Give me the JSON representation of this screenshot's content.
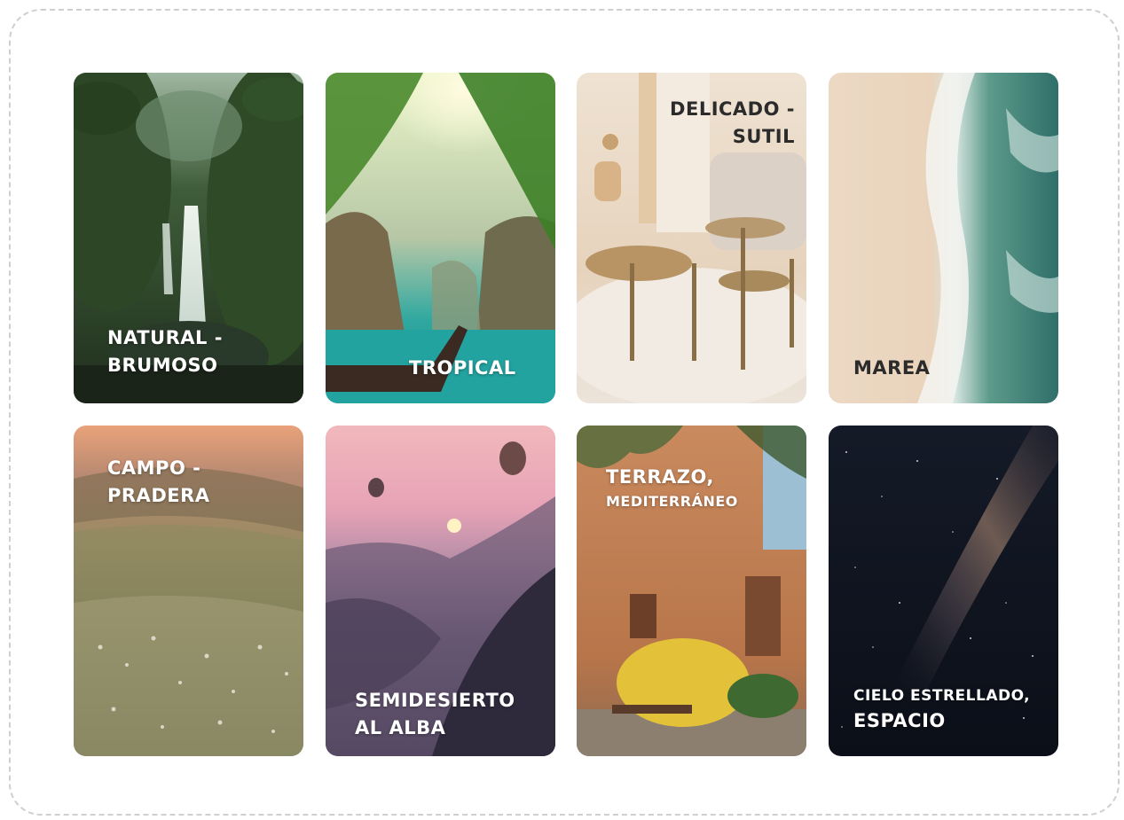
{
  "cards": [
    {
      "id": "natural",
      "lines": [
        "NATURAL -",
        "BRUMOSO"
      ]
    },
    {
      "id": "tropical",
      "lines": [
        "TROPICAL"
      ]
    },
    {
      "id": "delicado",
      "lines": [
        "DELICADO -",
        "SUTIL"
      ]
    },
    {
      "id": "marea",
      "lines": [
        "MAREA"
      ]
    },
    {
      "id": "campo",
      "lines": [
        "CAMPO -",
        "PRADERA"
      ]
    },
    {
      "id": "semidesierto",
      "lines": [
        "SEMIDESIERTO",
        "AL ALBA"
      ]
    },
    {
      "id": "terrazo",
      "lines": [
        "TERRAZO,",
        "MEDITERRÁNEO"
      ]
    },
    {
      "id": "cielo",
      "lines": [
        "CIELO ESTRELLADO,",
        "ESPACIO"
      ]
    }
  ]
}
